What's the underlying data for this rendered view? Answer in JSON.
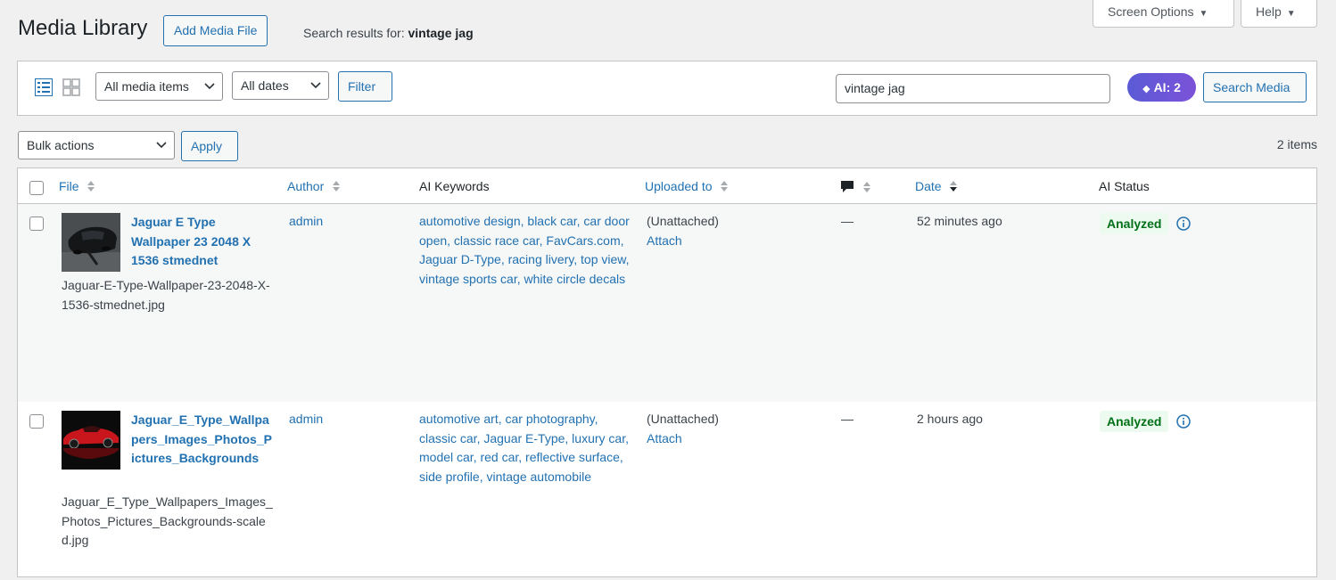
{
  "header": {
    "title": "Media Library",
    "add_button": "Add Media File",
    "search_prefix": "Search results for:",
    "search_term": "vintage jag",
    "screen_options": "Screen Options",
    "help": "Help"
  },
  "filter_bar": {
    "media_type": "All media items",
    "dates": "All dates",
    "filter_button": "Filter",
    "search_value": "vintage jag",
    "ai_pill": "AI: 2",
    "search_button": "Search Media"
  },
  "bulk": {
    "select": "Bulk actions",
    "apply": "Apply",
    "count": "2 items"
  },
  "columns": {
    "file": "File",
    "author": "Author",
    "ai_keywords": "AI Keywords",
    "uploaded_to": "Uploaded to",
    "date": "Date",
    "ai_status": "AI Status"
  },
  "rows": [
    {
      "title": "Jaguar E Type Wallpaper 23 2048 X 1536 stmednet",
      "filename": "Jaguar-E-Type-Wallpaper-23-2048-X-1536-stmednet.jpg",
      "author": "admin",
      "keywords": "automotive design, black car, car door open, classic race car, FavCars.com, Jaguar D-Type, racing livery, top view, vintage sports car, white circle decals",
      "uploaded_status": "(Unattached)",
      "attach": "Attach",
      "comments": "—",
      "date": "52 minutes ago",
      "ai_status": "Analyzed"
    },
    {
      "title": "Jaguar_E_Type_Wallpapers_Images_Photos_Pictures_Backgrounds",
      "filename": "Jaguar_E_Type_Wallpapers_Images_Photos_Pictures_Backgrounds-scaled.jpg",
      "author": "admin",
      "keywords": "automotive art, car photography, classic car, Jaguar E-Type, luxury car, model car, red car, reflective surface, side profile, vintage automobile",
      "uploaded_status": "(Unattached)",
      "attach": "Attach",
      "comments": "—",
      "date": "2 hours ago",
      "ai_status": "Analyzed"
    }
  ],
  "colors": {
    "link": "#2271b1",
    "ai_pill": "#6c5ce7",
    "analyzed_bg": "#edfaef",
    "analyzed_text": "#007017"
  }
}
